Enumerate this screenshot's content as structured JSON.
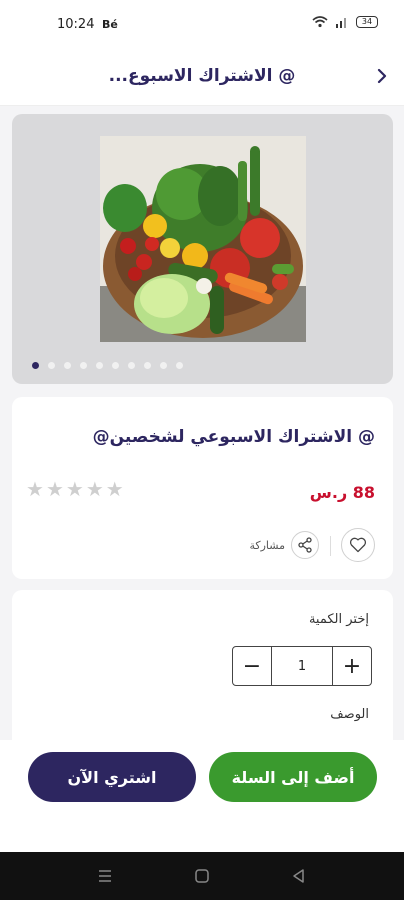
{
  "status_bar": {
    "time": "10:24",
    "carrier": "Bé",
    "battery": "34"
  },
  "header": {
    "title": "@ الاشتراك الاسبوع..."
  },
  "gallery": {
    "image_count": 10,
    "active_index": 0,
    "image_alt": "vegetables-basket"
  },
  "product": {
    "name": "@ الاشتراك الاسبوعي لشخصين@",
    "price": "88 ر.س",
    "rating": 0,
    "max_rating": 5,
    "share_label": "مشاركة"
  },
  "quantity": {
    "label": "إختر الكمية",
    "value": "1",
    "minus": "−",
    "plus": "+"
  },
  "description": {
    "label": "الوصف"
  },
  "actions": {
    "buy_now": "اشتري الآن",
    "add_to_cart": "أضف إلى السلة"
  },
  "colors": {
    "brand": "#2d2660",
    "price": "#c8102e",
    "cart": "#3a9a2e"
  }
}
